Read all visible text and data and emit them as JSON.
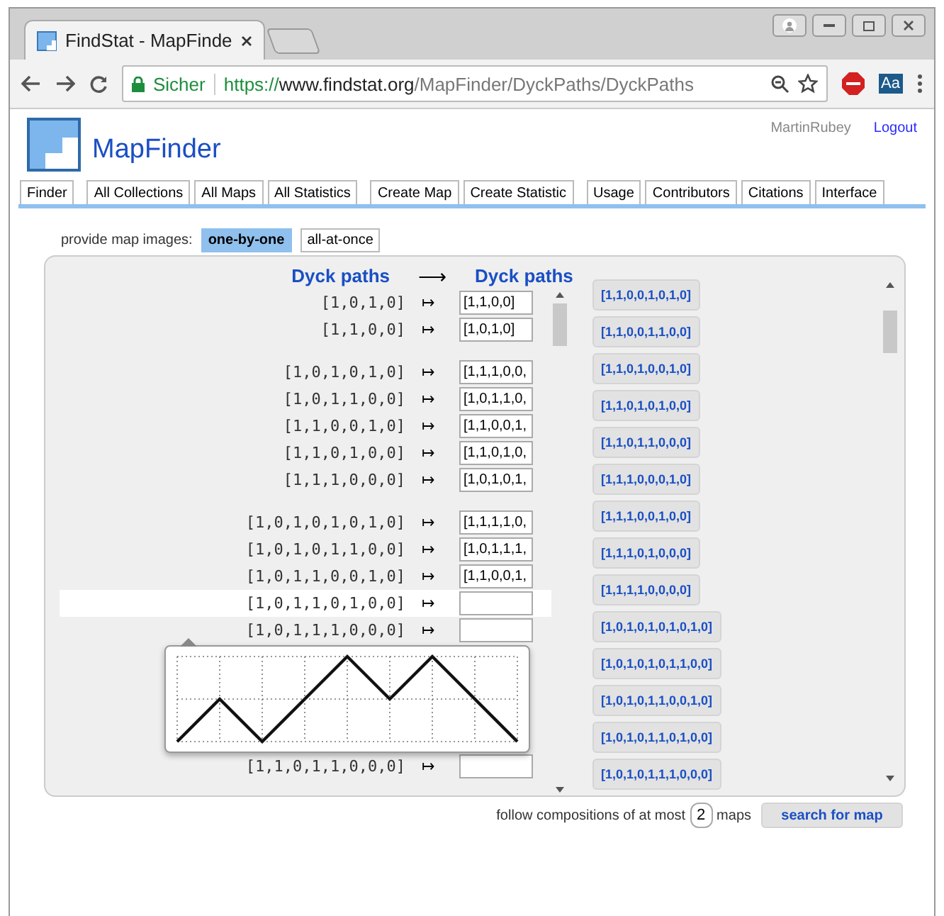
{
  "browser": {
    "tab_title": "FindStat - MapFinde",
    "secure_label": "Sicher",
    "url_scheme": "https://",
    "url_host": "www.findstat.org",
    "url_path": "/MapFinder/DyckPaths/DyckPaths",
    "extension_label": "Aa"
  },
  "header": {
    "title": "MapFinder",
    "user": "MartinRubey",
    "logout": "Logout"
  },
  "nav_groups": [
    [
      "Finder"
    ],
    [
      "All Collections",
      "All Maps",
      "All Statistics"
    ],
    [
      "Create Map",
      "Create Statistic"
    ],
    [
      "Usage",
      "Contributors",
      "Citations",
      "Interface"
    ]
  ],
  "image_mode": {
    "label": "provide map images:",
    "options": [
      {
        "label": "one-by-one",
        "selected": true
      },
      {
        "label": "all-at-once",
        "selected": false
      }
    ]
  },
  "map": {
    "source_header": "Dyck paths",
    "arrow": "⟶",
    "target_header": "Dyck paths",
    "groups": [
      [
        {
          "kind": "row",
          "source": "[1,0,1,0]",
          "mapsto": "↦",
          "value": "[1,1,0,0]",
          "highlighted": false
        },
        {
          "kind": "row",
          "source": "[1,1,0,0]",
          "mapsto": "↦",
          "value": "[1,0,1,0]",
          "highlighted": false
        }
      ],
      [
        {
          "kind": "row",
          "source": "[1,0,1,0,1,0]",
          "mapsto": "↦",
          "value": "[1,1,1,0,0,",
          "highlighted": false
        },
        {
          "kind": "row",
          "source": "[1,0,1,1,0,0]",
          "mapsto": "↦",
          "value": "[1,0,1,1,0,",
          "highlighted": false
        },
        {
          "kind": "row",
          "source": "[1,1,0,0,1,0]",
          "mapsto": "↦",
          "value": "[1,1,0,0,1,",
          "highlighted": false
        },
        {
          "kind": "row",
          "source": "[1,1,0,1,0,0]",
          "mapsto": "↦",
          "value": "[1,1,0,1,0,",
          "highlighted": false
        },
        {
          "kind": "row",
          "source": "[1,1,1,0,0,0]",
          "mapsto": "↦",
          "value": "[1,0,1,0,1,",
          "highlighted": false
        }
      ],
      [
        {
          "kind": "row",
          "source": "[1,0,1,0,1,0,1,0]",
          "mapsto": "↦",
          "value": "[1,1,1,1,0,",
          "highlighted": false
        },
        {
          "kind": "row",
          "source": "[1,0,1,0,1,1,0,0]",
          "mapsto": "↦",
          "value": "[1,0,1,1,1,",
          "highlighted": false
        },
        {
          "kind": "row",
          "source": "[1,0,1,1,0,0,1,0]",
          "mapsto": "↦",
          "value": "[1,1,0,0,1,",
          "highlighted": false
        },
        {
          "kind": "row",
          "source": "[1,0,1,1,0,1,0,0]",
          "mapsto": "↦",
          "highlighted": true
        },
        {
          "kind": "row",
          "source": "[1,0,1,1,1,0,0,0]",
          "mapsto": "↦",
          "highlighted": false
        },
        {
          "kind": "preview"
        },
        {
          "kind": "row",
          "source": "[1,1,0,1,1,0,0,0]",
          "mapsto": "↦",
          "highlighted": false
        }
      ]
    ],
    "targets": [
      "[1,1,0,0,1,0,1,0]",
      "[1,1,0,0,1,1,0,0]",
      "[1,1,0,1,0,0,1,0]",
      "[1,1,0,1,0,1,0,0]",
      "[1,1,0,1,1,0,0,0]",
      "[1,1,1,0,0,0,1,0]",
      "[1,1,1,0,0,1,0,0]",
      "[1,1,1,0,1,0,0,0]",
      "[1,1,1,1,0,0,0,0]",
      "[1,0,1,0,1,0,1,0,1,0]",
      "[1,0,1,0,1,0,1,1,0,0]",
      "[1,0,1,0,1,1,0,0,1,0]",
      "[1,0,1,0,1,1,0,1,0,0]",
      "[1,0,1,0,1,1,1,0,0,0]"
    ]
  },
  "footer": {
    "text_before": "follow compositions of at most",
    "count": "2",
    "text_after": "maps",
    "button": "search for map"
  }
}
